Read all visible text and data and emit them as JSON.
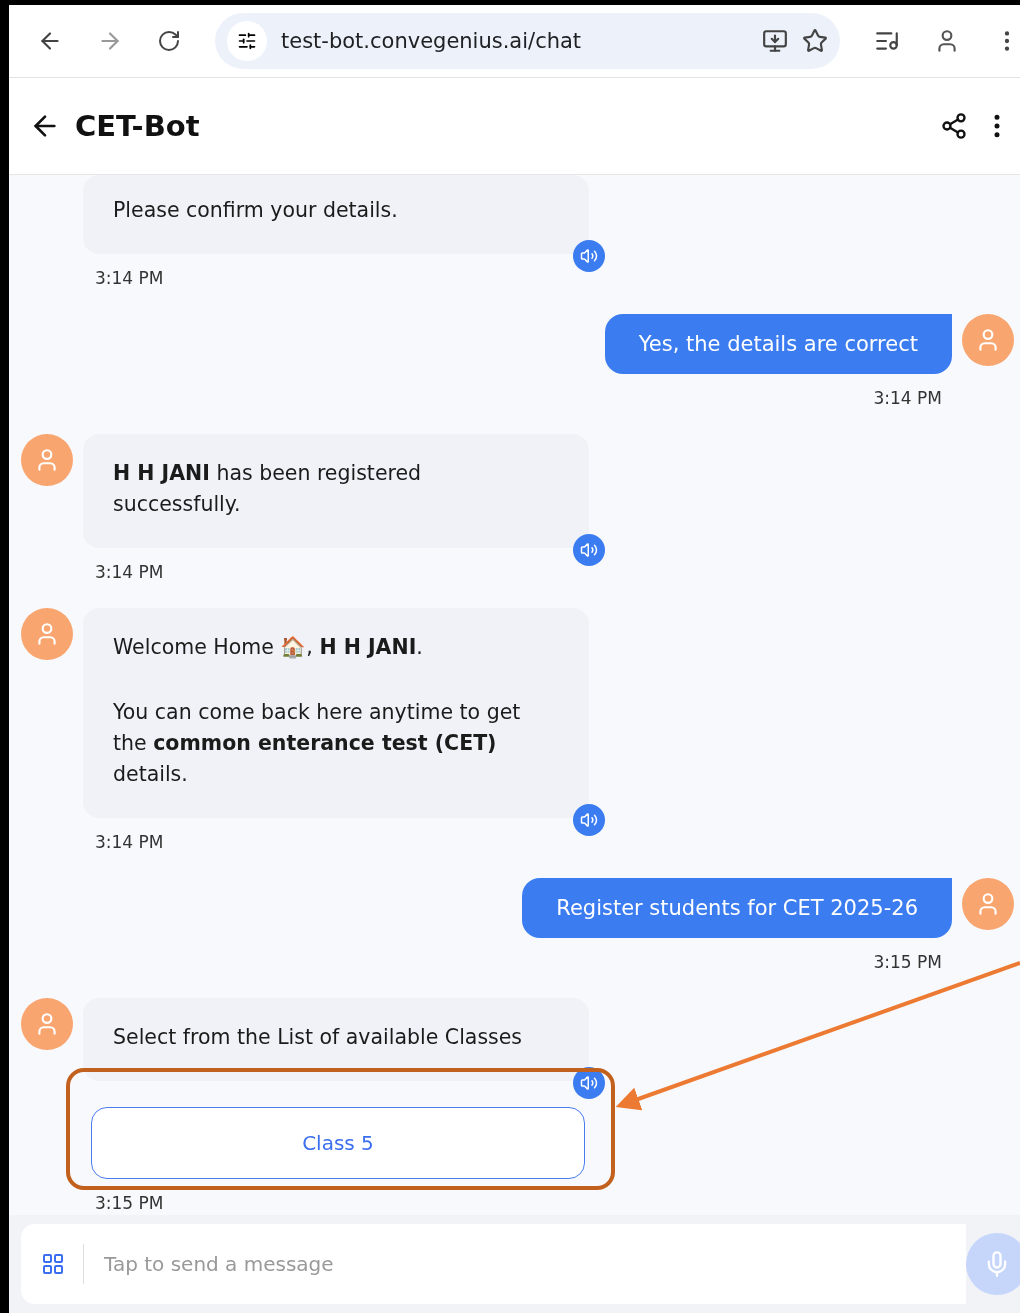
{
  "browser": {
    "url": "test-bot.convegenius.ai/chat"
  },
  "header": {
    "title": "CET-Bot"
  },
  "messages": [
    {
      "kind": "bot",
      "avatar": false,
      "paragraphs": [
        "Please confirm your details."
      ],
      "time": "3:14 PM"
    },
    {
      "kind": "user",
      "paragraphs": [
        "Yes, the details are correct"
      ],
      "time": "3:14 PM"
    },
    {
      "kind": "bot",
      "avatar": true,
      "paragraphs": [
        "**H H JANI** has been registered successfully."
      ],
      "time": "3:14 PM"
    },
    {
      "kind": "bot",
      "avatar": true,
      "paragraphs": [
        "Welcome Home 🏠, **H H JANI**.",
        "You can come back here anytime to get the **common enterance test (CET)** details."
      ],
      "time": "3:14 PM"
    },
    {
      "kind": "user",
      "paragraphs": [
        "Register students for CET 2025-26"
      ],
      "time": "3:15 PM"
    },
    {
      "kind": "bot",
      "avatar": true,
      "paragraphs": [
        "Select from the List of available Classes"
      ],
      "options": [
        "Class 5"
      ],
      "time": "3:15 PM"
    }
  ],
  "composer": {
    "placeholder": "Tap to send a message"
  }
}
